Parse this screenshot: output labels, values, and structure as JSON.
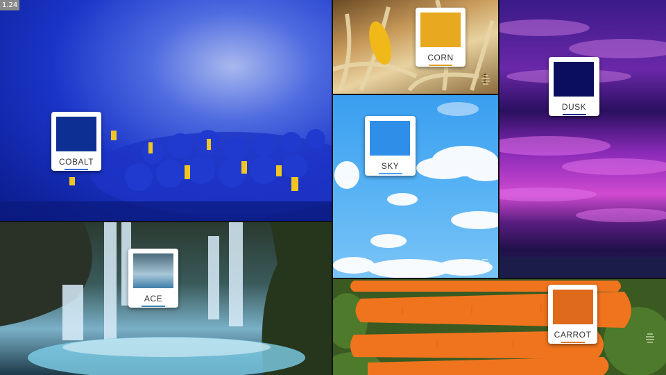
{
  "version": "1.24",
  "tiles": [
    {
      "name": "COBALT",
      "color": "#0d2f93",
      "underline": "#3a6fd8"
    },
    {
      "name": "CORN",
      "color": "#e8a820",
      "underline": "#e0a020"
    },
    {
      "name": "DUSK",
      "color": "#0a0e5c",
      "underline": "#1a2a90"
    },
    {
      "name": "SKY",
      "color": "#2f8ee8",
      "underline": "#4aa0f0"
    },
    {
      "name": "ACE",
      "color": "#3e7ea8",
      "underline": "#3b86b8"
    },
    {
      "name": "CARROT",
      "color": "#e06a1c",
      "underline": "#e07a30"
    }
  ],
  "icons": {
    "hive": "beehive-icon"
  }
}
